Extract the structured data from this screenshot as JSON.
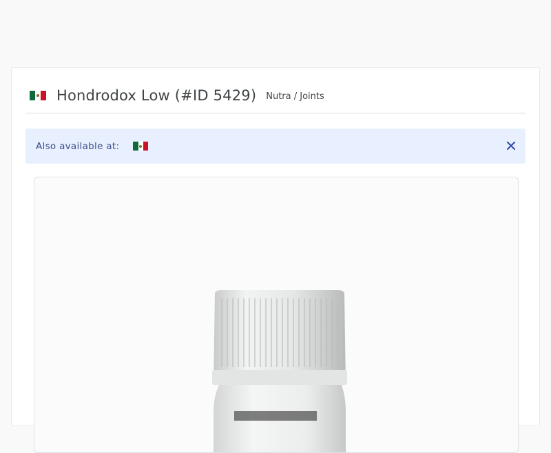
{
  "offer": {
    "title": "Hondrodox Low (#ID 5429)",
    "category": "Nutra / Joints",
    "country_flag": "mexico-flag-icon"
  },
  "alert": {
    "text": "Also available at:",
    "flags": [
      "mexico-flag-icon"
    ],
    "close_icon": "close-icon",
    "accent_color": "#3a4f86",
    "background_color": "#e8efff"
  },
  "product_image": {
    "description_icon": "product-bottle-image"
  }
}
